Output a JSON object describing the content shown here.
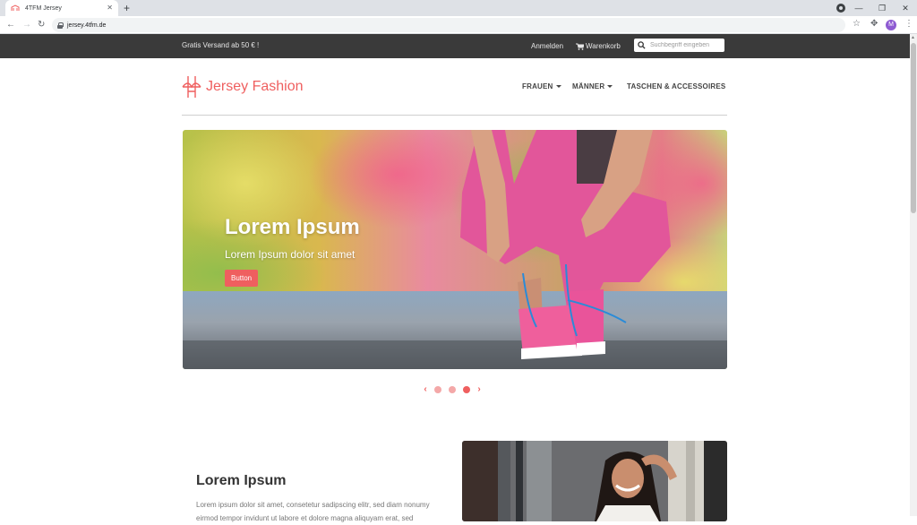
{
  "browser": {
    "tab_title": "4TFM Jersey",
    "url": "jersey.4tfm.de",
    "profile_initial": "M"
  },
  "topbar": {
    "shipping": "Gratis Versand ab 50 € !",
    "login": "Anmelden",
    "cart": "Warenkorb",
    "search_placeholder": "Suchbegriff eingeben"
  },
  "header": {
    "brand": "Jersey Fashion",
    "nav": [
      {
        "label": "FRAUEN",
        "dropdown": true
      },
      {
        "label": "MÄNNER",
        "dropdown": true
      },
      {
        "label": "TASCHEN & ACCESSOIRES",
        "dropdown": false
      }
    ]
  },
  "hero": {
    "title": "Lorem Ipsum",
    "subtitle": "Lorem Ipsum dolor sit amet",
    "button": "Button",
    "slide_count": 3,
    "active_slide": 3
  },
  "section": {
    "title": "Lorem Ipsum",
    "text": "Lorem ipsum dolor sit amet, consetetur sadipscing elitr, sed diam nonumy eirmod tempor invidunt ut labore et dolore magna aliquyam erat, sed"
  },
  "colors": {
    "accent": "#ef5f5f",
    "topbar": "#3a3a3a"
  }
}
